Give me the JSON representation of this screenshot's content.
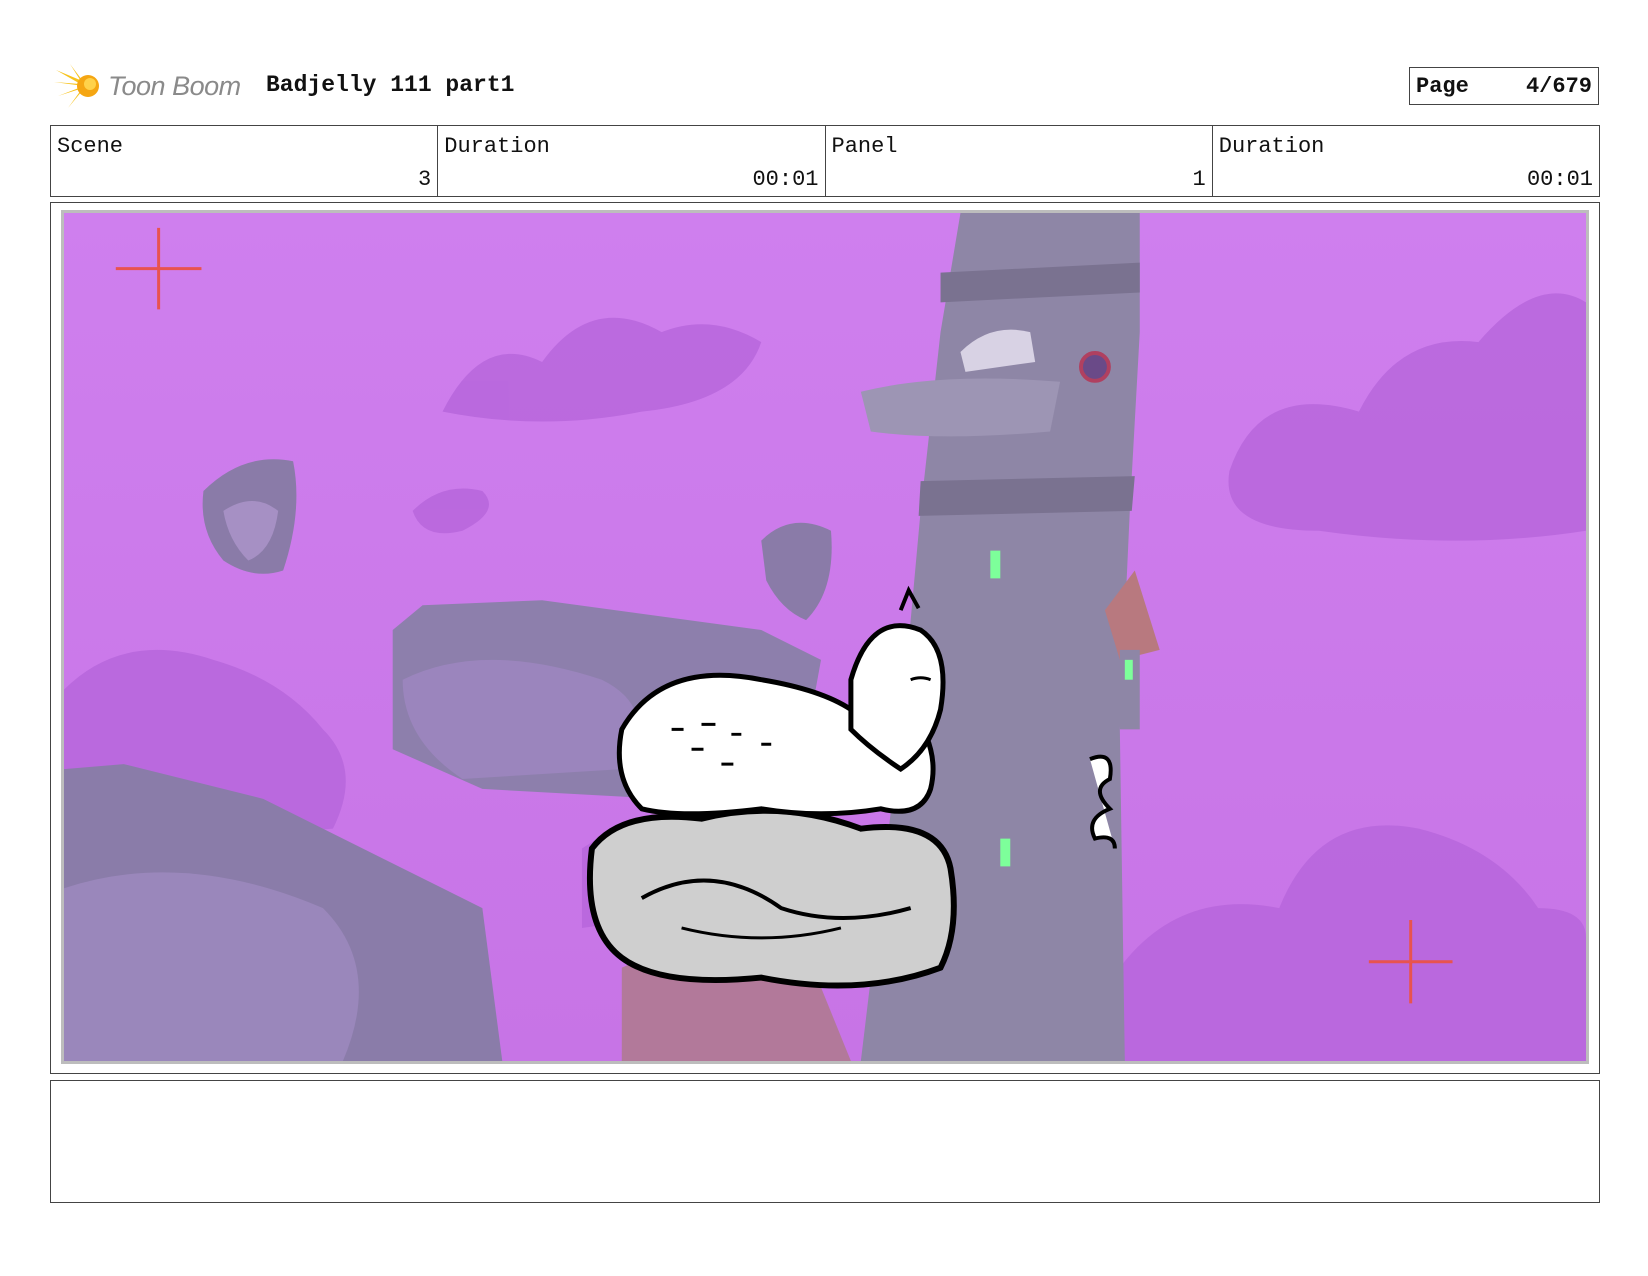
{
  "header": {
    "logo_text": "Toon Boom",
    "title": "Badjelly 111 part1",
    "page_label": "Page",
    "page_value": "4/679"
  },
  "info": [
    {
      "label": "Scene",
      "value": "3"
    },
    {
      "label": "Duration",
      "value": "00:01"
    },
    {
      "label": "Panel",
      "value": "1"
    },
    {
      "label": "Duration",
      "value": "00:01"
    }
  ],
  "panel": {
    "sky_color": "#c97ae9",
    "cloud_color": "#b565da",
    "rock_color": "#8f7fb0",
    "tower_color": "#8e86a6",
    "safe_mark_color": "#e8534f",
    "window_glow": "#7dff9a",
    "icons": [
      "crosshair-icon",
      "crosshair-icon"
    ]
  },
  "notes": {
    "text": ""
  }
}
